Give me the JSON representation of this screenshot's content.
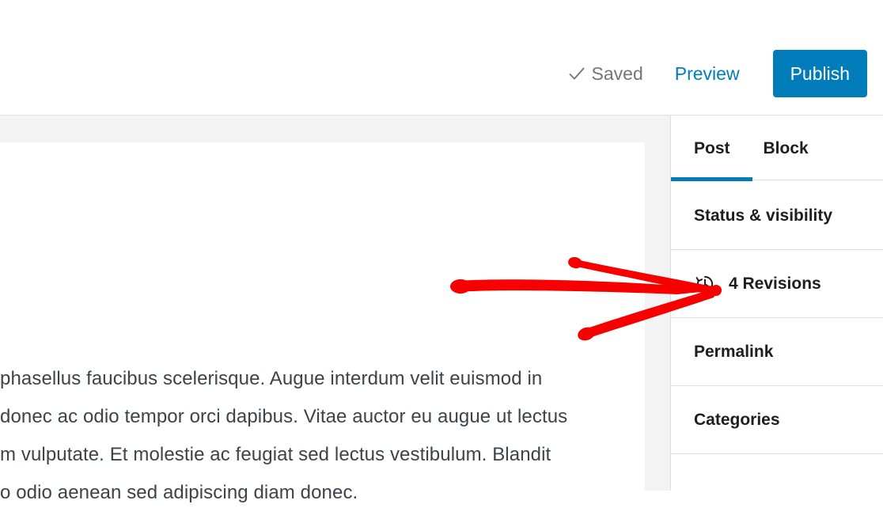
{
  "app": {
    "name": "WordPress Block Editor",
    "accent_color": "#007cba",
    "annotation_color": "#f90000",
    "text_color": "#3c434a",
    "muted_text_color": "#757575",
    "border_color": "#e0e0e0",
    "canvas_bg": "#f3f3f4"
  },
  "header": {
    "saved_label": "Saved",
    "saved_icon": "check-icon",
    "preview_label": "Preview",
    "publish_label": "Publish"
  },
  "sidebar": {
    "tabs": [
      {
        "label": "Post",
        "active": true
      },
      {
        "label": "Block",
        "active": false
      }
    ],
    "panels": [
      {
        "label": "Status & visibility",
        "icon": null
      },
      {
        "label": "4 Revisions",
        "icon": "revisions-clock-icon"
      },
      {
        "label": "Permalink",
        "icon": null
      },
      {
        "label": "Categories",
        "icon": null
      }
    ]
  },
  "post": {
    "body_lines": [
      "phasellus faucibus scelerisque. Augue interdum velit euismod in",
      "donec ac odio tempor orci dapibus. Vitae auctor eu augue ut lectus",
      "m vulputate. Et molestie ac feugiat sed lectus vestibulum. Blandit",
      "o odio aenean sed adipiscing diam donec."
    ]
  },
  "annotation": {
    "type": "hand-drawn-arrow",
    "points_to": "4 Revisions",
    "color": "#f90000"
  }
}
